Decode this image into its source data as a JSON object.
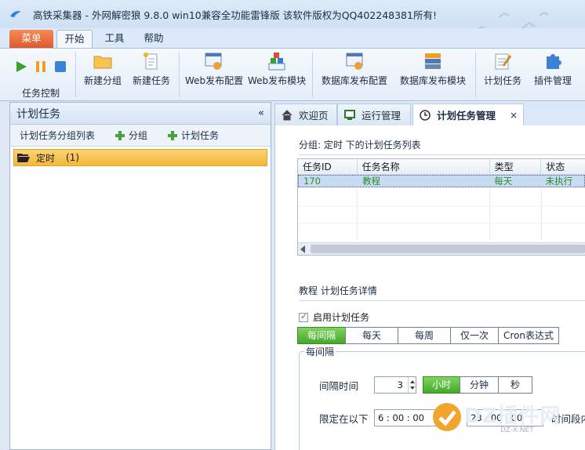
{
  "window": {
    "title": "高铁采集器 - 外网解密狼 9.8.0 win10兼容全功能雷锋版  该软件版权为QQ402248381所有!"
  },
  "ribbon_tabs": [
    "菜单",
    "开始",
    "工具",
    "帮助"
  ],
  "ribbon": {
    "group_label": "任务控制",
    "buttons": [
      "新建分组",
      "新建任务",
      "Web发布配置",
      "Web发布模块",
      "数据库发布配置",
      "数据库发布模块",
      "计划任务",
      "插件管理"
    ]
  },
  "left_panel": {
    "title": "计划任务",
    "collapse": "«",
    "toolbar": {
      "label": "计划任务分组列表",
      "add_group": "分组",
      "add_task": "计划任务"
    },
    "tree": [
      {
        "name": "定时",
        "count": "(1)"
      }
    ]
  },
  "tabs": [
    {
      "label": "欢迎页"
    },
    {
      "label": "运行管理"
    },
    {
      "label": "计划任务管理",
      "close": "×"
    }
  ],
  "task_list": {
    "title": "分组: 定时  下的计划任务列表",
    "columns": [
      "任务ID",
      "任务名称",
      "类型",
      "状态"
    ],
    "rows": [
      {
        "id": "170",
        "name": "教程",
        "type": "每天",
        "status": "未执行"
      }
    ]
  },
  "detail": {
    "title": "教程 计划任务详情",
    "enable_label": "启用计划任务",
    "enabled": true,
    "schedule_types": [
      "每间隔",
      "每天",
      "每周",
      "仅一次",
      "Cron表达式"
    ],
    "selected_type": "每间隔",
    "group_legend": "每间隔",
    "interval_label": "间隔时间",
    "interval_value": "3",
    "units": [
      "小时",
      "分钟",
      "秒"
    ],
    "selected_unit": "小时",
    "limit_label": "限定在以下",
    "time_from": "6 : 00 : 00",
    "time_to": "23 : 00 : 00",
    "time_suffix": "时间段内"
  },
  "watermark": {
    "text": "DZ插件网",
    "sub": "DZ-X.NET"
  }
}
